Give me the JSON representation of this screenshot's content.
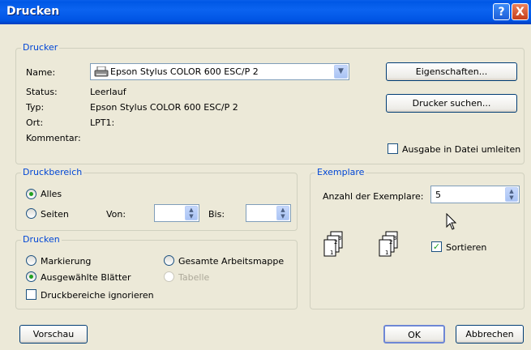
{
  "window": {
    "title": "Drucken",
    "help": "?",
    "close": "X"
  },
  "printer": {
    "group_label": "Drucker",
    "name_label": "Name:",
    "name_value": "Epson Stylus COLOR 600 ESC/P 2",
    "status_label": "Status:",
    "status_value": "Leerlauf",
    "type_label": "Typ:",
    "type_value": "Epson Stylus COLOR 600 ESC/P 2",
    "location_label": "Ort:",
    "location_value": "LPT1:",
    "comment_label": "Kommentar:",
    "properties_button": "Eigenschaften...",
    "find_button": "Drucker suchen...",
    "print_to_file": "Ausgabe in Datei umleiten"
  },
  "range": {
    "group_label": "Druckbereich",
    "all": "Alles",
    "pages": "Seiten",
    "from_label": "Von:",
    "to_label": "Bis:",
    "from_value": "",
    "to_value": ""
  },
  "copies": {
    "group_label": "Exemplare",
    "count_label": "Anzahl der Exemplare:",
    "count_value": "5",
    "collate": "Sortieren"
  },
  "print_what": {
    "group_label": "Drucken",
    "selection": "Markierung",
    "workbook": "Gesamte Arbeitsmappe",
    "active_sheets": "Ausgewählte Blätter",
    "table": "Tabelle",
    "ignore_areas": "Druckbereiche ignorieren"
  },
  "buttons": {
    "preview": "Vorschau",
    "ok": "OK",
    "cancel": "Abbrechen"
  }
}
